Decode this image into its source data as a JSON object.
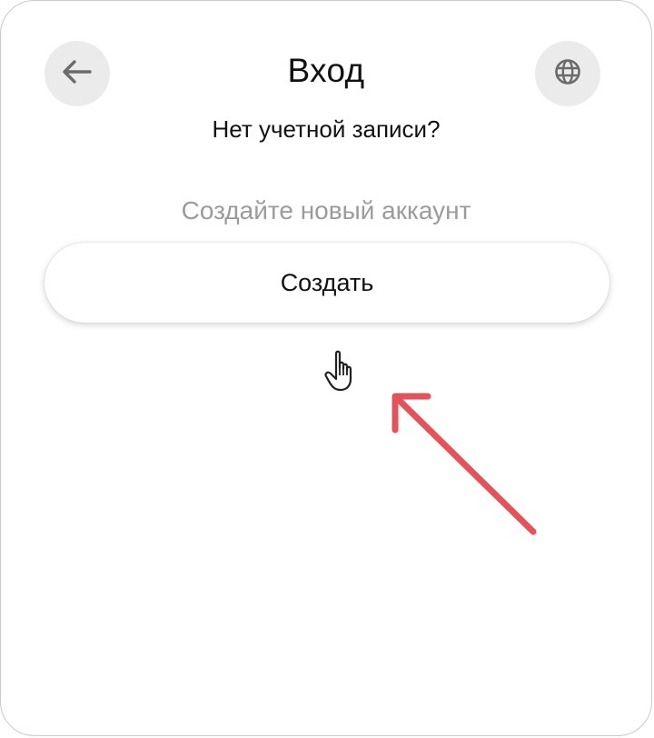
{
  "header": {
    "title": "Вход",
    "back_icon": "arrow-left-icon",
    "language_icon": "globe-icon"
  },
  "signup": {
    "question": "Нет учетной записи?",
    "hint": "Создайте новый аккаунт",
    "button_label": "Создать"
  },
  "colors": {
    "icon_button_bg": "#ebebeb",
    "hint_text": "#9b9b9b",
    "annotation_arrow": "#e5535a"
  }
}
